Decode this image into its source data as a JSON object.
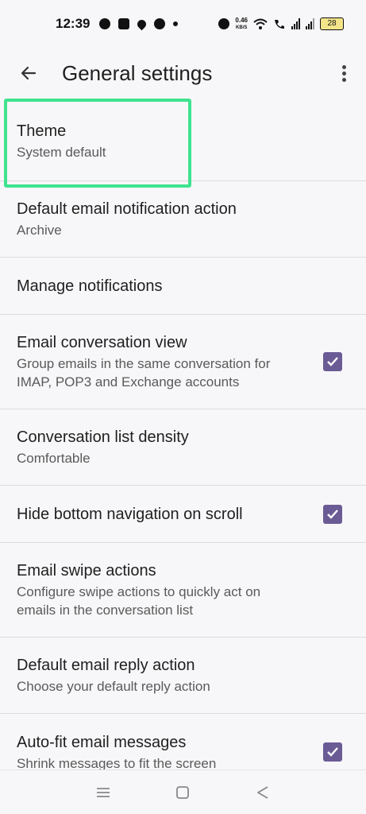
{
  "status_bar": {
    "time": "12:39",
    "net_speed_value": "0.46",
    "net_speed_unit": "KB/S",
    "battery": "28",
    "icons": [
      "whatsapp-icon",
      "message-icon",
      "location-icon",
      "app-icon",
      "dot-icon",
      "alarm-icon",
      "wifi-icon",
      "volte-call-icon",
      "signal-icon",
      "signal-icon"
    ]
  },
  "app_bar": {
    "title": "General settings",
    "back_icon": "arrow-back-icon",
    "more_icon": "more-vert-icon"
  },
  "settings": [
    {
      "title": "Theme",
      "summary": "System default",
      "checkbox": null,
      "highlighted": true
    },
    {
      "title": "Default email notification action",
      "summary": "Archive",
      "checkbox": null
    },
    {
      "title": "Manage notifications",
      "summary": "",
      "checkbox": null
    },
    {
      "title": "Email conversation view",
      "summary": "Group emails in the same conversation for IMAP, POP3 and Exchange accounts",
      "checkbox": true
    },
    {
      "title": "Conversation list density",
      "summary": "Comfortable",
      "checkbox": null
    },
    {
      "title": "Hide bottom navigation on scroll",
      "summary": "",
      "checkbox": true
    },
    {
      "title": "Email swipe actions",
      "summary": "Configure swipe actions to quickly act on emails in the conversation list",
      "checkbox": null
    },
    {
      "title": "Default email reply action",
      "summary": "Choose your default reply action",
      "checkbox": null
    },
    {
      "title": "Auto-fit email messages",
      "summary": "Shrink messages to fit the screen",
      "checkbox": true
    }
  ],
  "colors": {
    "checkbox": "#6b5b95",
    "highlight": "#3fe38f",
    "background": "#f7f7f9"
  },
  "nav_bar": {
    "icons": [
      "menu-icon",
      "home-icon",
      "back-triangle-icon"
    ]
  }
}
